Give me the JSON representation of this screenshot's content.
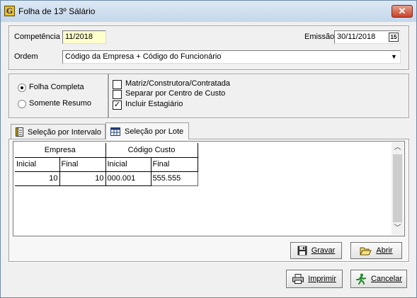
{
  "window": {
    "title": "Folha de 13º Sálário",
    "app_icon_glyph": "G",
    "close_glyph": "✕"
  },
  "header": {
    "competencia_label": "Competência",
    "competencia_value": "11/2018",
    "emissao_label": "Emissão",
    "emissao_value": "30/11/2018",
    "calendar_glyph": "15",
    "ordem_label": "Ordem",
    "ordem_value": "Código da Empresa + Código do Funcionário"
  },
  "options": {
    "radio_folha_completa": "Folha Completa",
    "radio_somente_resumo": "Somente Resumo",
    "selected_radio": "Folha Completa",
    "check_matriz": "Matriz/Construtora/Contratada",
    "check_separar": "Separar por Centro de Custo",
    "check_incluir": "Incluir Estagiário",
    "checked_incluir": "✓"
  },
  "tabs": [
    {
      "label": "Seleção por Intervalo",
      "active": false
    },
    {
      "label": "Seleção por Lote",
      "active": true
    }
  ],
  "grid": {
    "group_headers": [
      "Empresa",
      "Código Custo"
    ],
    "sub_headers": [
      "Inicial",
      "Final",
      "Inicial",
      "Final"
    ],
    "rows": [
      [
        "10",
        "10",
        "000.001",
        "555.555"
      ]
    ]
  },
  "buttons": {
    "gravar": "Gravar",
    "abrir": "Abrir",
    "imprimir": "Imprimir",
    "cancelar": "Cancelar"
  },
  "colors": {
    "highlight_field": "#ffffcc",
    "window_bg": "#f0f0f0",
    "close_button": "#c7422a"
  }
}
